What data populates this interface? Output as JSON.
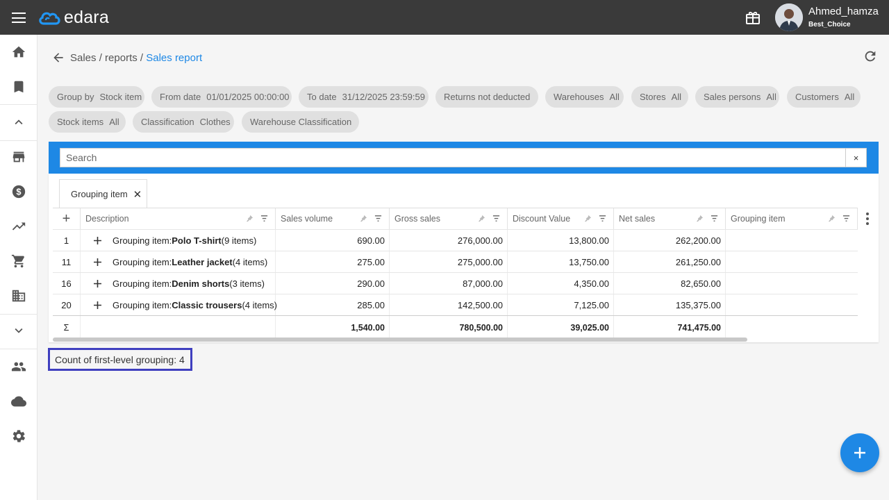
{
  "app": {
    "brand": "edara"
  },
  "user": {
    "name": "Ahmed_hamza",
    "company": "Best_Choice"
  },
  "breadcrumb": {
    "part1": "Sales",
    "sep": " / ",
    "part2": "reports",
    "current": "Sales report"
  },
  "filters": [
    {
      "label": "Group by",
      "value": "Stock item"
    },
    {
      "label": "From date",
      "value": "01/01/2025 00:00:00"
    },
    {
      "label": "To date",
      "value": "31/12/2025 23:59:59"
    },
    {
      "label": "Returns not deducted",
      "value": ""
    },
    {
      "label": "Warehouses",
      "value": "All"
    },
    {
      "label": "Stores",
      "value": "All"
    },
    {
      "label": "Sales persons",
      "value": "All"
    },
    {
      "label": "Customers",
      "value": "All"
    },
    {
      "label": "Stock items",
      "value": "All"
    },
    {
      "label": "Classification",
      "value": "Clothes"
    },
    {
      "label": "Warehouse Classification",
      "value": ""
    }
  ],
  "search": {
    "placeholder": "Search",
    "clear": "×"
  },
  "group_panel": {
    "chip_label": "Grouping item"
  },
  "grid": {
    "add_symbol": "+",
    "columns": [
      "Description",
      "Sales volume",
      "Gross sales",
      "Discount Value",
      "Net sales",
      "Grouping item"
    ],
    "rows": [
      {
        "index": "1",
        "prefix": "Grouping item:",
        "name": "Polo T-shirt",
        "count": "(9 items)",
        "sales_volume": "690.00",
        "gross_sales": "276,000.00",
        "discount": "13,800.00",
        "net_sales": "262,200.00"
      },
      {
        "index": "11",
        "prefix": "Grouping item:",
        "name": "Leather jacket",
        "count": "(4 items)",
        "sales_volume": "275.00",
        "gross_sales": "275,000.00",
        "discount": "13,750.00",
        "net_sales": "261,250.00"
      },
      {
        "index": "16",
        "prefix": "Grouping item:",
        "name": "Denim shorts",
        "count": "(3 items)",
        "sales_volume": "290.00",
        "gross_sales": "87,000.00",
        "discount": "4,350.00",
        "net_sales": "82,650.00"
      },
      {
        "index": "20",
        "prefix": "Grouping item:",
        "name": "Classic trousers",
        "count": "(4 items)",
        "sales_volume": "285.00",
        "gross_sales": "142,500.00",
        "discount": "7,125.00",
        "net_sales": "135,375.00"
      }
    ],
    "totals": {
      "symbol": "Σ",
      "sales_volume": "1,540.00",
      "gross_sales": "780,500.00",
      "discount": "39,025.00",
      "net_sales": "741,475.00"
    }
  },
  "footer": {
    "count_text": "Count of first-level grouping: 4"
  },
  "colors": {
    "accent": "#1e88e5",
    "topbar": "#3a3a3a",
    "highlight_border": "#3f3fbf"
  }
}
